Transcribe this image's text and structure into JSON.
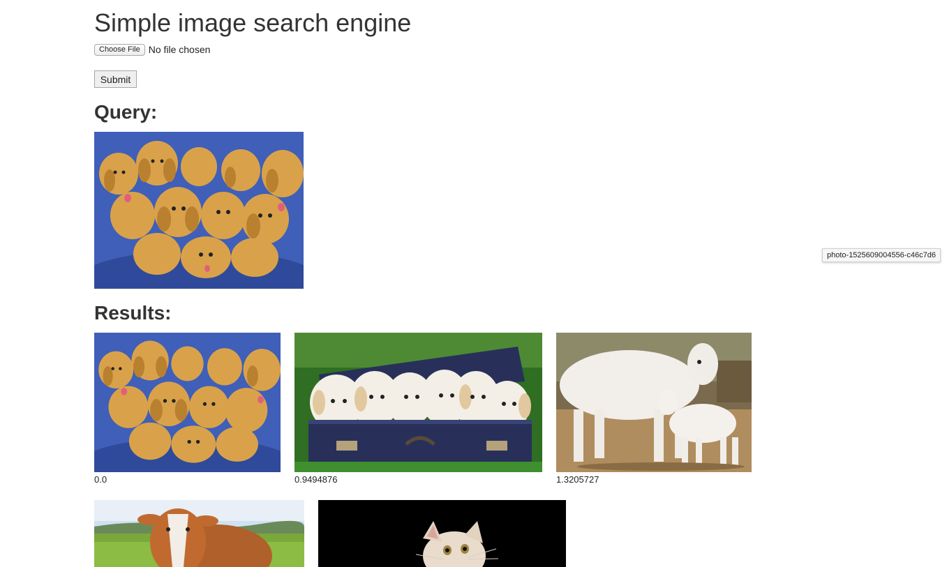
{
  "header": {
    "title": "Simple image search engine"
  },
  "upload": {
    "choose_file_label": "Choose File",
    "file_status": "No file chosen",
    "submit_label": "Submit"
  },
  "query": {
    "heading": "Query:",
    "image": {
      "subject": "golden retriever puppies on blue cushion"
    }
  },
  "results": {
    "heading": "Results:",
    "items": [
      {
        "subject": "golden retriever puppies on blue cushion",
        "score": "0.0"
      },
      {
        "subject": "white puppies in blue suitcase on grass",
        "score": "0.9494876"
      },
      {
        "subject": "white cow with calf",
        "score": "1.3205727"
      },
      {
        "subject": "brown and white cow in field",
        "score": ""
      },
      {
        "subject": "kitten on black background",
        "score": ""
      }
    ]
  },
  "tooltip": {
    "text": "photo-1525609004556-c46c7d6"
  },
  "colors": {
    "cushion_blue": "#3f5fb8",
    "puppy_gold": "#d9a24a",
    "grass_green": "#3f8f2f",
    "suitcase_navy": "#28305a"
  }
}
